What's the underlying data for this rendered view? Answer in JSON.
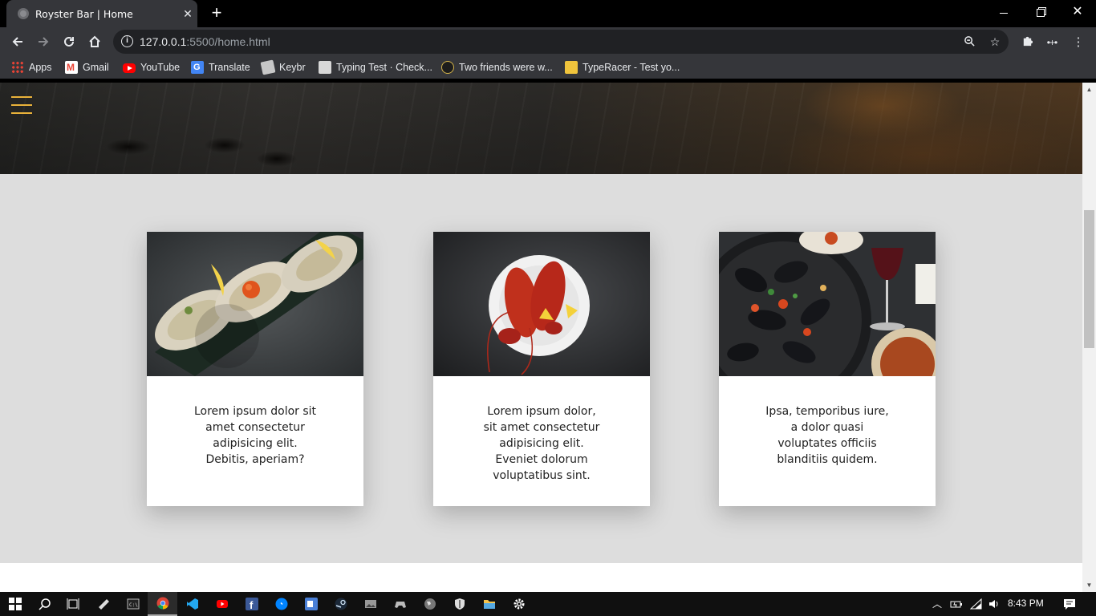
{
  "browser": {
    "tab_title": "Royster Bar | Home",
    "url_host": "127.0.0.1",
    "url_path": ":5500/home.html",
    "bookmarks": [
      {
        "label": "Apps",
        "icon": "apps-grid-icon"
      },
      {
        "label": "Gmail",
        "icon": "gmail-icon"
      },
      {
        "label": "YouTube",
        "icon": "youtube-icon"
      },
      {
        "label": "Translate",
        "icon": "translate-icon"
      },
      {
        "label": "Keybr",
        "icon": "keybr-icon"
      },
      {
        "label": "Typing Test · Check...",
        "icon": "typing-test-icon"
      },
      {
        "label": "Two friends were w...",
        "icon": "two-friends-icon"
      },
      {
        "label": "TypeRacer - Test yo...",
        "icon": "typeracer-icon"
      }
    ]
  },
  "page": {
    "accent_color": "#e9b23a",
    "background_color": "#dddddd",
    "cards": [
      {
        "image": "oysters-photo",
        "text": "Lorem ipsum dolor sit amet consectetur adipisicing elit. Debitis, aperiam?"
      },
      {
        "image": "lobster-photo",
        "text": "Lorem ipsum dolor, sit amet consectetur adipisicing elit. Eveniet dolorum voluptatibus sint."
      },
      {
        "image": "mussels-photo",
        "text": "Ipsa, temporibus iure, a dolor quasi voluptates officiis blanditiis quidem."
      }
    ]
  },
  "taskbar": {
    "apps": [
      "start",
      "search",
      "task-view",
      "file-tool",
      "terminal",
      "chrome",
      "vscode",
      "youtube",
      "facebook",
      "messenger",
      "outlook",
      "steam",
      "photos",
      "controller",
      "globe",
      "shield",
      "file-explorer",
      "settings"
    ],
    "active_app": "chrome",
    "clock": "8:43 PM"
  }
}
